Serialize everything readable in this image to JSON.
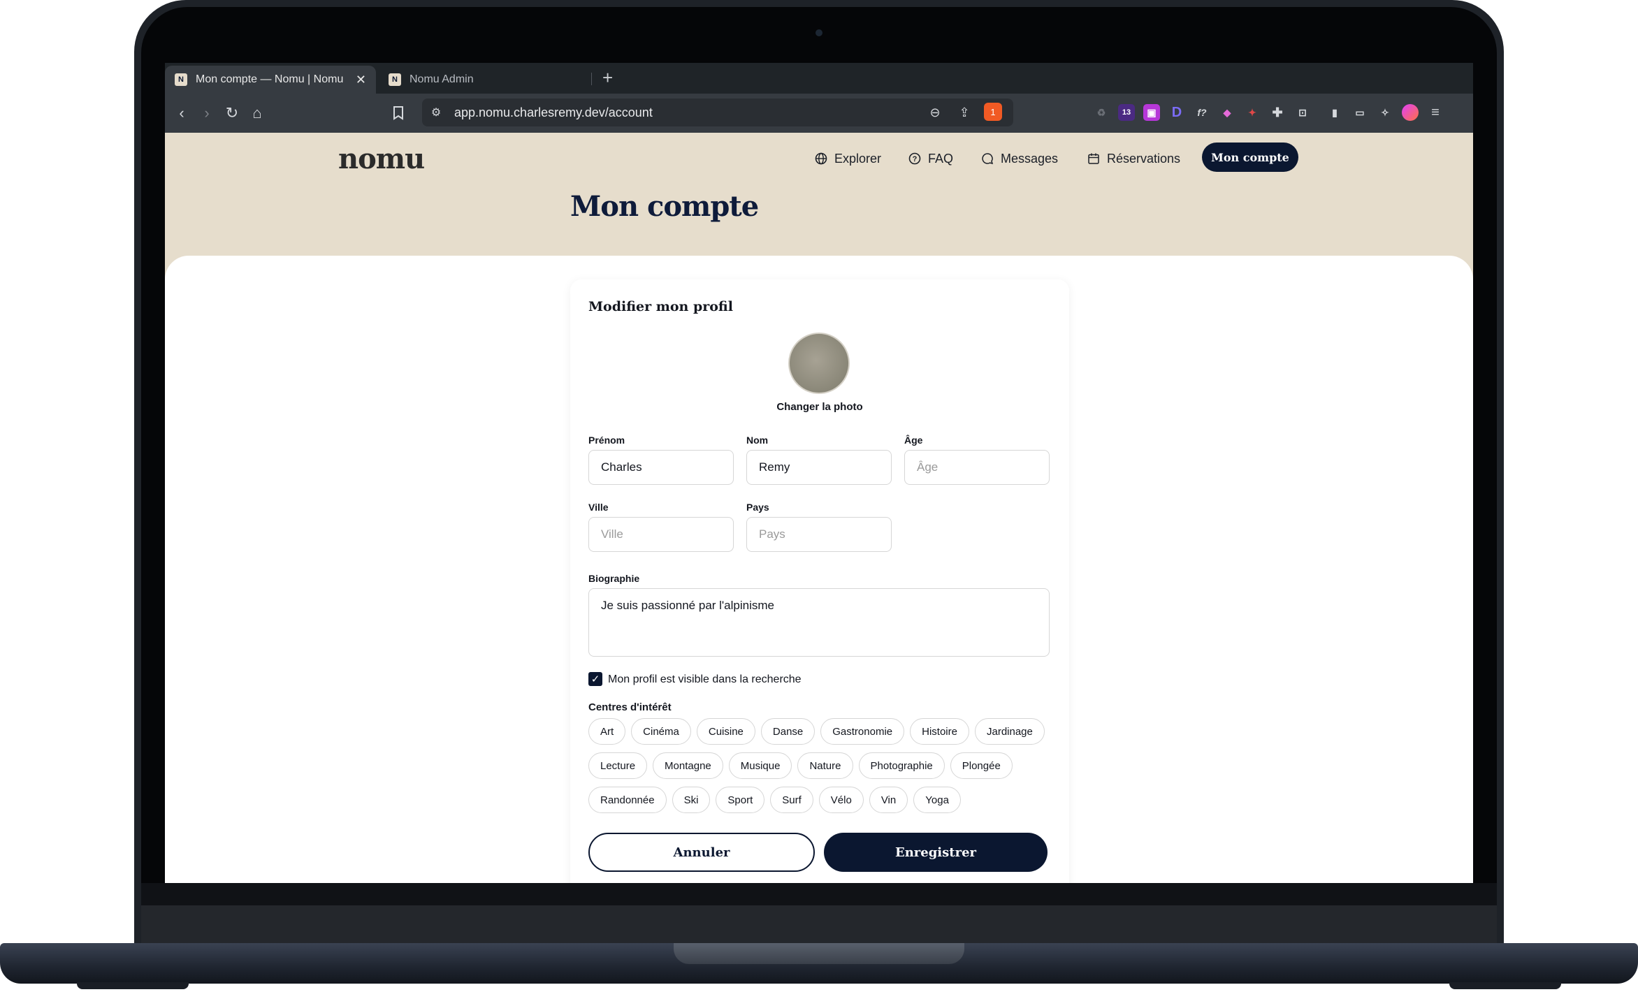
{
  "browser": {
    "tabs": [
      {
        "label": "Mon compte — Nomu | Nomu",
        "active": true
      },
      {
        "label": "Nomu Admin",
        "active": false
      }
    ],
    "url": "app.nomu.charlesremy.dev/account",
    "extension_badge": "13",
    "brave_badge": "1"
  },
  "header": {
    "logo": "nomu",
    "nav": [
      {
        "label": "Explorer",
        "icon": "globe-icon"
      },
      {
        "label": "FAQ",
        "icon": "help-circle-icon"
      },
      {
        "label": "Messages",
        "icon": "chat-bubble-icon"
      },
      {
        "label": "Réservations",
        "icon": "calendar-icon"
      }
    ],
    "cta": "Mon compte"
  },
  "page": {
    "title": "Mon compte"
  },
  "profile_form": {
    "title": "Modifier mon profil",
    "change_photo": "Changer la photo",
    "first_name": {
      "label": "Prénom",
      "value": "Charles",
      "placeholder": ""
    },
    "last_name": {
      "label": "Nom",
      "value": "Remy",
      "placeholder": ""
    },
    "age": {
      "label": "Âge",
      "value": "",
      "placeholder": "Âge"
    },
    "city": {
      "label": "Ville",
      "value": "",
      "placeholder": "Ville"
    },
    "country": {
      "label": "Pays",
      "value": "",
      "placeholder": "Pays"
    },
    "bio": {
      "label": "Biographie",
      "value": "Je suis passionné par l'alpinisme"
    },
    "visible_checkbox": {
      "label": "Mon profil est visible dans la recherche",
      "checked": true
    },
    "interests_title": "Centres d'intérêt",
    "interests": [
      "Art",
      "Cinéma",
      "Cuisine",
      "Danse",
      "Gastronomie",
      "Histoire",
      "Jardinage",
      "Lecture",
      "Montagne",
      "Musique",
      "Nature",
      "Photographie",
      "Plongée",
      "Randonnée",
      "Ski",
      "Sport",
      "Surf",
      "Vélo",
      "Vin",
      "Yoga"
    ],
    "cancel_label": "Annuler",
    "save_label": "Enregistrer"
  },
  "colors": {
    "primary": "#0b1730",
    "header_bg": "#e6ddcc",
    "brave_orange": "#f15a24"
  }
}
